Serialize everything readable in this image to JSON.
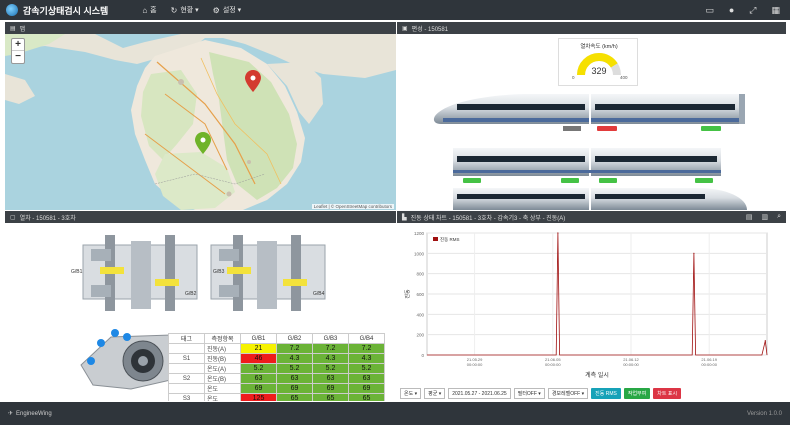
{
  "app": {
    "title": "감속기상태검시 시스템"
  },
  "nav": [
    {
      "label": "홈",
      "icon": "home-icon"
    },
    {
      "label": "현황 ▾",
      "icon": "history-icon"
    },
    {
      "label": "설정 ▾",
      "icon": "settings-icon"
    }
  ],
  "top_icons": [
    "window-icon",
    "user-icon",
    "expand-icon",
    "grid-icon"
  ],
  "map_panel": {
    "title": "맵",
    "zoom_in": "+",
    "zoom_out": "−",
    "attribution": "Leaflet | © OpenStreetMap contributors"
  },
  "train_panel": {
    "title": "편성 - 150581",
    "speed_title": "열차속도 (km/h)",
    "speed_value": "329",
    "speed_min": "0",
    "speed_max": "400",
    "speed_fraction": 0.82
  },
  "bogie_panel": {
    "title": "열차 - 150581 - 3호차",
    "sensor_labels": [
      "G/B1",
      "G/B2",
      "G/B3",
      "G/B4"
    ],
    "table": {
      "headers": [
        "태그",
        "측정항목",
        "G/B1",
        "G/B2",
        "G/B3",
        "G/B4"
      ],
      "rows": [
        {
          "tag": "",
          "item": "진동(A)",
          "values": [
            "21",
            "7.2",
            "7.2",
            "7.2"
          ],
          "status": [
            "yellow",
            "green",
            "green",
            "green"
          ]
        },
        {
          "tag": "S1",
          "item": "진동(B)",
          "values": [
            "46",
            "4.3",
            "4.3",
            "4.3"
          ],
          "status": [
            "red",
            "green",
            "green",
            "green"
          ]
        },
        {
          "tag": "",
          "item": "온도(A)",
          "values": [
            "5.2",
            "5.2",
            "5.2",
            "5.2"
          ],
          "status": [
            "green",
            "green",
            "green",
            "green"
          ]
        },
        {
          "tag": "S2",
          "item": "온도(B)",
          "values": [
            "63",
            "63",
            "63",
            "63"
          ],
          "status": [
            "green",
            "green",
            "green",
            "green"
          ]
        },
        {
          "tag": "",
          "item": "온도",
          "values": [
            "69",
            "69",
            "69",
            "69"
          ],
          "status": [
            "green",
            "green",
            "green",
            "green"
          ]
        },
        {
          "tag": "S3",
          "item": "온도",
          "values": [
            "125",
            "65",
            "65",
            "65"
          ],
          "status": [
            "red",
            "green",
            "green",
            "green"
          ]
        },
        {
          "tag": "S4",
          "item": "온도",
          "values": [
            "71",
            "71",
            "71",
            "71"
          ],
          "status": [
            "green",
            "green",
            "green",
            "green"
          ]
        },
        {
          "tag": "S5",
          "item": "온도",
          "values": [
            "67",
            "67",
            "67",
            "67"
          ],
          "status": [
            "green",
            "green",
            "green",
            "green"
          ]
        }
      ]
    }
  },
  "chart_panel": {
    "title": "진동 상태 차트 - 150581 - 3호차 - 감속기3 - 축 상부 - 진동(A)",
    "controls": {
      "axis": "온도",
      "type": "평균",
      "date_range": "2021.05.27 - 2021.06.25",
      "filter": "필터OFF",
      "alarm": "경보레벨OFF",
      "btn_rms": "진동 RMS",
      "btn_alarm": "작업부여",
      "btn_report": "차트 표시"
    }
  },
  "chart_data": {
    "type": "line",
    "title": "",
    "xlabel": "계측 일시",
    "ylabel": "진동",
    "series": [
      {
        "name": "진동 RMS",
        "color": "#a01010"
      }
    ],
    "ylim": [
      0,
      1200
    ],
    "yticks": [
      "0",
      "200",
      "400",
      "600",
      "800",
      "1000",
      "1200"
    ],
    "xticks": [
      "21.05.29\n00:00:00",
      "21.06.05\n00:00:00",
      "21.06.12\n00:00:00",
      "21.06.19\n00:00:00"
    ],
    "points": [
      {
        "x": 0.0,
        "y": 0
      },
      {
        "x": 0.38,
        "y": 0
      },
      {
        "x": 0.385,
        "y": 1200
      },
      {
        "x": 0.39,
        "y": 0
      },
      {
        "x": 0.78,
        "y": 0
      },
      {
        "x": 0.785,
        "y": 1000
      },
      {
        "x": 0.79,
        "y": 0
      },
      {
        "x": 0.985,
        "y": 0
      },
      {
        "x": 0.995,
        "y": 140
      },
      {
        "x": 1.0,
        "y": 0
      }
    ]
  },
  "footer": {
    "brand": "EngineeWing",
    "version": "Version 1.0.0"
  }
}
